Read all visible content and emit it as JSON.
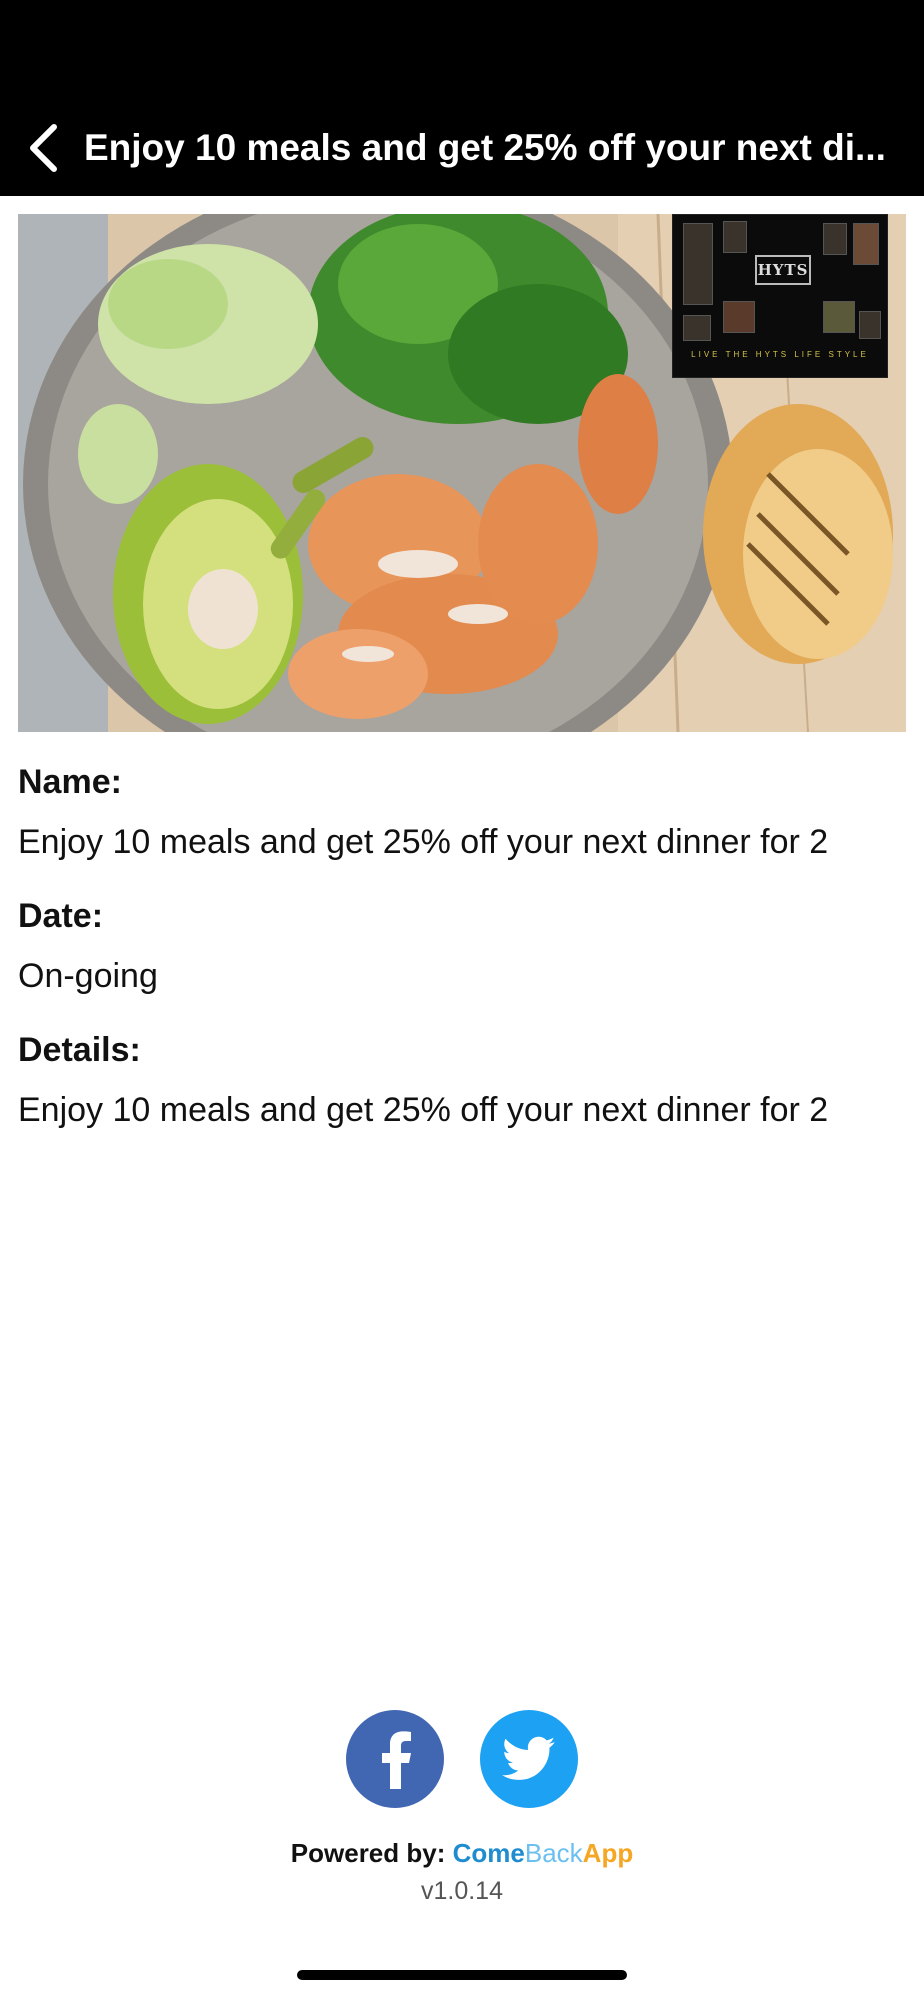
{
  "header": {
    "title": "Enjoy 10 meals and get 25% off your next di...",
    "back_icon": "chevron-left-icon"
  },
  "hero": {
    "logo_text": "HYTS",
    "logo_tagline": "LIVE THE HYTS LIFE STYLE"
  },
  "details": {
    "name_label": "Name:",
    "name_value": "Enjoy 10 meals and get 25% off your next dinner for 2",
    "date_label": "Date:",
    "date_value": "On-going",
    "details_label": "Details:",
    "details_value": "Enjoy 10 meals and get 25% off your next dinner for 2"
  },
  "footer": {
    "social": [
      {
        "name": "facebook",
        "icon": "facebook-icon",
        "color": "#4267b2"
      },
      {
        "name": "twitter",
        "icon": "twitter-icon",
        "color": "#1da1f2"
      }
    ],
    "powered_label": "Powered by:",
    "brand_come": "Come",
    "brand_back": "Back",
    "brand_app": "App",
    "version": "v1.0.14"
  },
  "colors": {
    "header_bg": "#000000",
    "brand_blue": "#1e8ccf",
    "brand_light_blue": "#6cc0f0",
    "brand_orange": "#f5a623"
  }
}
